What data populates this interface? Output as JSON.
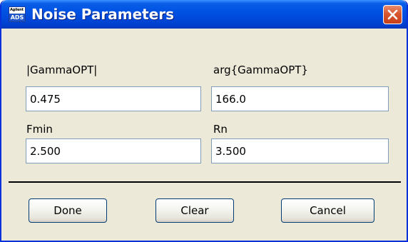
{
  "window": {
    "title": "Noise Parameters",
    "icon": {
      "top_text": "Agilent",
      "bottom_text": "ADS"
    }
  },
  "fields": {
    "gamma_opt_mag": {
      "label": "|GammaOPT|",
      "value": "0.475"
    },
    "gamma_opt_arg": {
      "label": "arg{GammaOPT}",
      "value": "166.0"
    },
    "fmin": {
      "label": "Fmin",
      "value": "2.500"
    },
    "rn": {
      "label": "Rn",
      "value": "3.500"
    }
  },
  "buttons": {
    "done": "Done",
    "clear": "Clear",
    "cancel": "Cancel"
  },
  "colors": {
    "titlebar": "#0052e3",
    "close_button": "#d8572f",
    "dialog_background": "#ece9d8",
    "field_border": "#7f9db9"
  }
}
